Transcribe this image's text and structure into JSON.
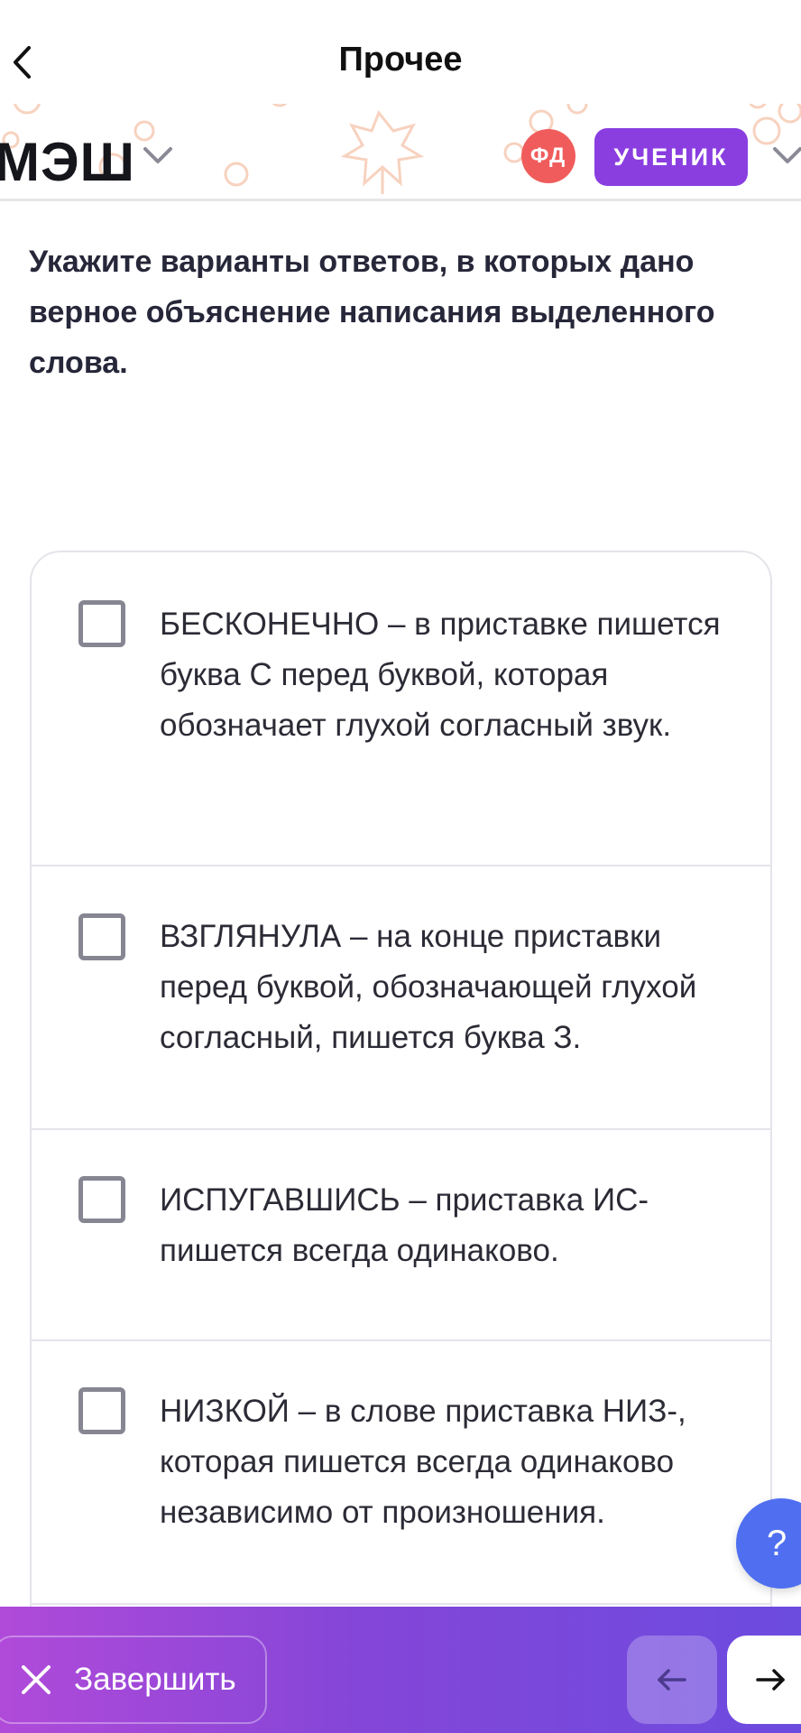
{
  "nav": {
    "back_icon": "chevron-left-icon",
    "title": "Прочее"
  },
  "header": {
    "logo": "МЭШ",
    "avatar_initials": "ФД",
    "role": "УЧЕНИК",
    "colors": {
      "avatar": "#f05c5c",
      "role_badge": "#8a3ee0"
    }
  },
  "question": {
    "text": "Укажите варианты ответов, в которых дано верное объяснение написания выделенного слова."
  },
  "options": [
    {
      "text": "БЕСКОНЕЧНО – в приставке пишется буква С перед буквой, которая обозначает глухой согласный звук.",
      "checked": false
    },
    {
      "text": "ВЗГЛЯНУЛА – на конце приставки перед буквой, обозначающей глухой согласный, пишется буква З.",
      "checked": false
    },
    {
      "text": "ИСПУГАВШИСЬ – приставка ИС- пишется всегда одинаково.",
      "checked": false
    },
    {
      "text": "НИЗКОЙ – в слове приставка НИЗ-, которая пишется всегда одинаково независимо от произношения.",
      "checked": false
    }
  ],
  "help": {
    "label": "?"
  },
  "footer": {
    "finish_label": "Завершить",
    "finish_icon": "close-icon",
    "prev_icon": "arrow-left-icon",
    "next_icon": "arrow-right-icon",
    "gradient": [
      "#b04ad9",
      "#6c4bdf"
    ]
  }
}
